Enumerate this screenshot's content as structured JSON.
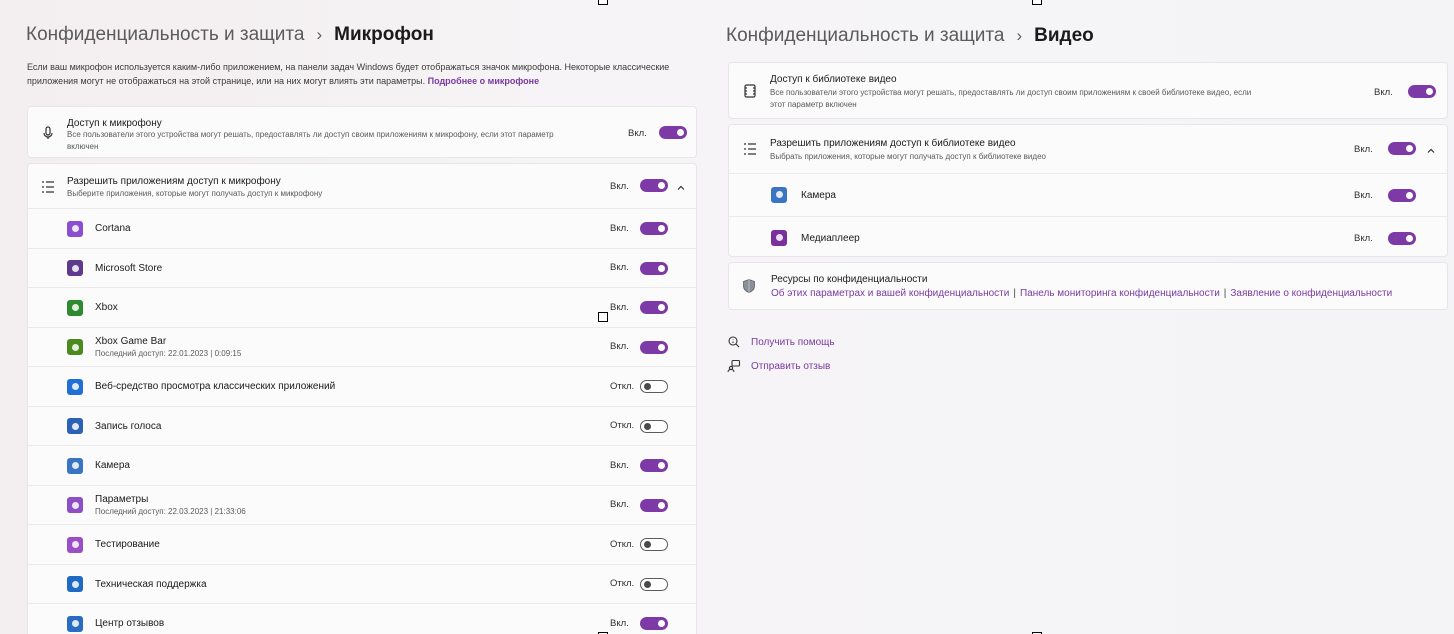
{
  "left": {
    "breadcrumb": {
      "parent": "Конфиденциальность и защита",
      "separator": "›",
      "current": "Микрофон"
    },
    "description": {
      "line1": "Если ваш микрофон используется каким-либо приложением, на панели задач Windows будет отображаться значок микрофона. Некоторые классические",
      "line2": "приложения могут не отображаться на этой странице, или на них могут влиять эти параметры.",
      "link": "Подробнее о микрофоне"
    },
    "access": {
      "title": "Доступ к микрофону",
      "desc_line1": "Все пользователи этого устройства могут решать, предоставлять ли доступ своим приложениям к микрофону, если этот параметр",
      "desc_line2": "включен",
      "state": "Вкл."
    },
    "allow_apps": {
      "title": "Разрешить приложениям доступ к микрофону",
      "desc": "Выберите приложения, которые могут получать доступ к микрофону",
      "state": "Вкл."
    },
    "apps": [
      {
        "name": "Cortana",
        "detail": "",
        "state": "Вкл.",
        "on": true,
        "icon": "cortana-icon",
        "color": "#8a4fd0"
      },
      {
        "name": "Microsoft Store",
        "detail": "",
        "state": "Вкл.",
        "on": true,
        "icon": "store-icon",
        "color": "#5d3a8c"
      },
      {
        "name": "Xbox",
        "detail": "",
        "state": "Вкл.",
        "on": true,
        "icon": "xbox-icon",
        "color": "#2f8a2f"
      },
      {
        "name": "Xbox Game Bar",
        "detail": "Последний доступ: 22.01.2023  |  0:09:15",
        "state": "Вкл.",
        "on": true,
        "icon": "game-bar-icon",
        "color": "#4a8a1f"
      },
      {
        "name": "Веб-средство просмотра классических приложений",
        "detail": "",
        "state": "Откл.",
        "on": false,
        "icon": "web-viewer-icon",
        "color": "#1f6fd6"
      },
      {
        "name": "Запись голоса",
        "detail": "",
        "state": "Откл.",
        "on": false,
        "icon": "voice-recorder-icon",
        "color": "#2b62b8"
      },
      {
        "name": "Камера",
        "detail": "",
        "state": "Вкл.",
        "on": true,
        "icon": "camera-icon",
        "color": "#3a75c4"
      },
      {
        "name": "Параметры",
        "detail": "Последний доступ: 22.03.2023  |  21:33:06",
        "state": "Вкл.",
        "on": true,
        "icon": "settings-icon",
        "color": "#8e4fc6"
      },
      {
        "name": "Тестирование",
        "detail": "",
        "state": "Откл.",
        "on": false,
        "icon": "testing-icon",
        "color": "#9a4fc9"
      },
      {
        "name": "Техническая поддержка",
        "detail": "",
        "state": "Откл.",
        "on": false,
        "icon": "support-icon",
        "color": "#1f6ac4"
      },
      {
        "name": "Центр отзывов",
        "detail": "",
        "state": "Вкл.",
        "on": true,
        "icon": "feedback-hub-icon",
        "color": "#2a6cc2"
      }
    ]
  },
  "right": {
    "breadcrumb": {
      "parent": "Конфиденциальность и защита",
      "separator": "›",
      "current": "Видео"
    },
    "access": {
      "title": "Доступ к библиотеке видео",
      "desc_line1": "Все пользователи этого устройства могут решать, предоставлять ли доступ своим приложениям к своей библиотеке видео, если",
      "desc_line2": "этот параметр включен",
      "state": "Вкл."
    },
    "allow_apps": {
      "title": "Разрешить приложениям доступ к библиотеке видео",
      "desc": "Выбрать приложения, которые могут получать доступ к библиотеке видео",
      "state": "Вкл."
    },
    "apps": [
      {
        "name": "Камера",
        "state": "Вкл.",
        "on": true,
        "icon": "camera-icon",
        "color": "#3a75c4"
      },
      {
        "name": "Медиаплеер",
        "state": "Вкл.",
        "on": true,
        "icon": "media-player-icon",
        "color": "#7a2f9e"
      }
    ],
    "resources": {
      "title": "Ресурсы по конфиденциальности",
      "links": [
        "Об этих параметрах и вашей конфиденциальности",
        "Панель мониторинга конфиденциальности",
        "Заявление о конфиденциальности"
      ]
    },
    "footer": {
      "help": "Получить помощь",
      "feedback": "Отправить отзыв"
    }
  },
  "colors": {
    "accent": "#7d3aa6",
    "link": "#7a3aa0"
  }
}
